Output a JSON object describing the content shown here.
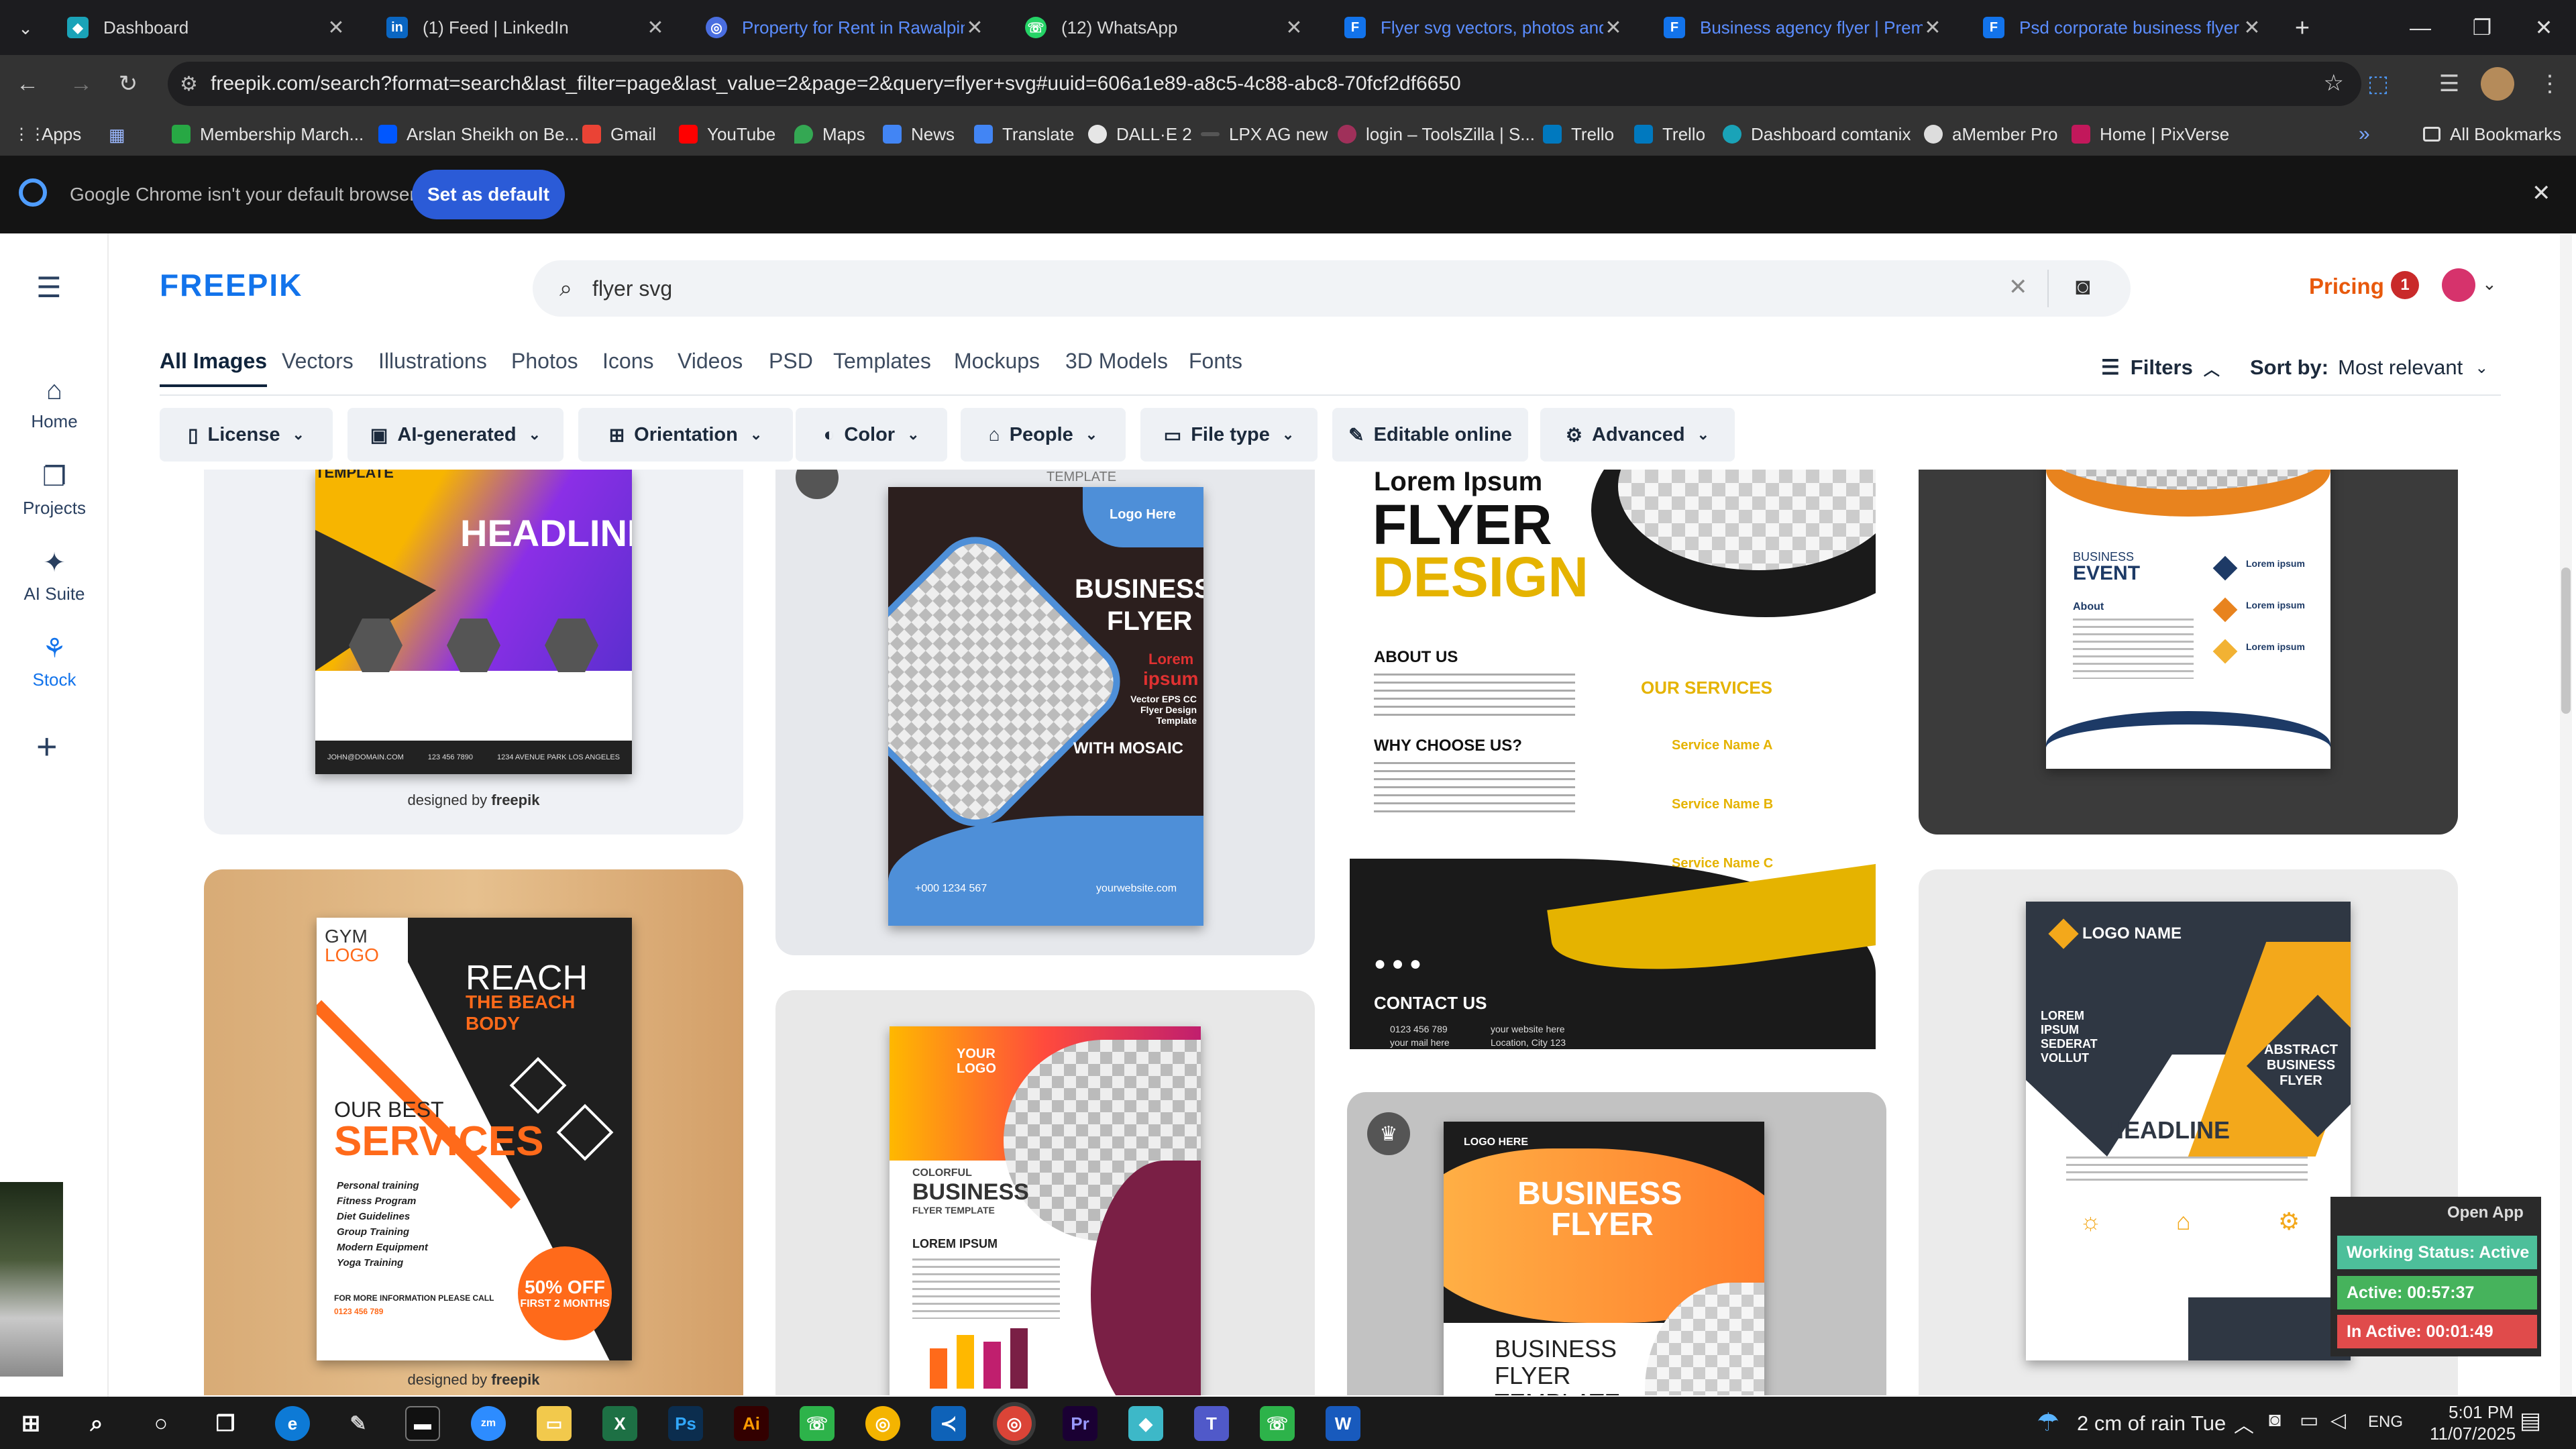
{
  "browser": {
    "tabs": [
      {
        "title": "Dashboard",
        "active": false
      },
      {
        "title": "(1) Feed | LinkedIn",
        "active": false
      },
      {
        "title": "Property for Rent in Rawalpindi",
        "active": false
      },
      {
        "title": "(12) WhatsApp",
        "active": false
      },
      {
        "title": "Flyer svg vectors, photos and P",
        "active": true
      },
      {
        "title": "Business agency flyer | Premium",
        "active": false
      },
      {
        "title": "Psd corporate business flyer de",
        "active": false
      }
    ],
    "new_tab": "+",
    "url": "freepik.com/search?format=search&last_filter=page&last_value=2&page=2&query=flyer+svg#uuid=606a1e89-a8c5-4c88-abc8-70fcf2df6650",
    "bookmarks": [
      "Apps",
      "Membership March...",
      "Arslan Sheikh on Be...",
      "Gmail",
      "YouTube",
      "Maps",
      "News",
      "Translate",
      "DALL·E 2",
      "LPX AG new",
      "login – ToolsZilla | S...",
      "Trello",
      "Trello",
      "Dashboard comtanix",
      "aMember Pro",
      "Home | PixVerse"
    ],
    "all_bookmarks": "All Bookmarks",
    "infobar": {
      "text": "Google Chrome isn't your default browser",
      "button": "Set as default"
    }
  },
  "freepik": {
    "logo": "FREEPIK",
    "search_value": "flyer svg",
    "pricing": "Pricing",
    "notif_count": "1",
    "sidebar": [
      {
        "label": "Home",
        "icon": "home-icon"
      },
      {
        "label": "Projects",
        "icon": "folder-icon"
      },
      {
        "label": "AI Suite",
        "icon": "sparkle-icon"
      },
      {
        "label": "Stock",
        "icon": "stock-icon"
      }
    ],
    "categories": [
      "All Images",
      "Vectors",
      "Illustrations",
      "Photos",
      "Icons",
      "Videos",
      "PSD",
      "Templates",
      "Mockups",
      "3D Models",
      "Fonts"
    ],
    "filters_label": "Filters",
    "sort_label": "Sort by:",
    "sort_value": "Most relevant",
    "chips": [
      "License",
      "AI-generated",
      "Orientation",
      "Color",
      "People",
      "File type",
      "Editable online",
      "Advanced"
    ]
  },
  "results": {
    "designed_by": "designed by",
    "designed_by_brand": "freepik",
    "card1": {
      "label_top": "TEMPLATE",
      "headline": "HEADLINE",
      "footer1": "JOHN@DOMAIN.COM",
      "footer2": "123 456 7890",
      "footer3": "1234 AVENUE PARK LOS ANGELES"
    },
    "card2": {
      "label_top": "TEMPLATE",
      "logo": "Logo Here",
      "title1": "BUSINESS",
      "title2": "FLYER",
      "lorem": "Lorem",
      "ipsum": "ipsum",
      "desc": "Vector EPS CC Flyer Design Template",
      "mosaic": "WITH MOSAIC",
      "phone": "+000 1234 567",
      "web": "yourwebsite.com"
    },
    "card3": {
      "lorem": "Lorem Ipsum",
      "flyer": "FLYER",
      "design": "DESIGN",
      "about": "ABOUT US",
      "why": "WHY CHOOSE US?",
      "services": "OUR SERVICES",
      "sa": "Service Name A",
      "sb": "Service Name B",
      "sc": "Service Name C",
      "contact": "CONTACT US",
      "phone": "0123 456 789",
      "mail": "your mail here",
      "web": "your website here",
      "loc": "Location, City 123"
    },
    "card4": {
      "business": "BUSINESS",
      "event": "EVENT",
      "about": "About",
      "lorem": "Lorem ipsum"
    },
    "card5": {
      "gym": "GYM",
      "logo": "LOGO",
      "reach": "REACH",
      "beach": "THE BEACH BODY",
      "our_best": "OUR BEST",
      "services": "SERVICES",
      "list": [
        "Personal training",
        "Fitness Program",
        "Diet Guidelines",
        "Group Training",
        "Modern Equipment",
        "Yoga Training"
      ],
      "more": "FOR MORE INFORMATION PLEASE CALL",
      "phone": "0123 456 789",
      "offer1": "50% OFF",
      "offer2": "FIRST 2 MONTHS"
    },
    "card6": {
      "your": "YOUR",
      "logo": "LOGO",
      "colorful": "COLORFUL",
      "business": "BUSINESS",
      "template": "FLYER TEMPLATE",
      "lorem": "LOREM IPSUM"
    },
    "card7": {
      "logo": "LOGO HERE",
      "title1": "BUSINESS",
      "title2": "FLYER",
      "title3": "BUSINESS",
      "title4": "FLYER",
      "title5": "TEMPLATE"
    },
    "card8": {
      "logo": "LOGO NAME",
      "lorem": "LOREM IPSUM SEDERAT VOLLUT",
      "abstract": "ABSTRACT BUSINESS FLYER",
      "headline": "HEADLINE"
    }
  },
  "overlay": {
    "open_app": "Open App",
    "status": "Working Status: Active",
    "active": "Active: 00:57:37",
    "inactive": "In Active: 00:01:49"
  },
  "taskbar": {
    "weather": "2 cm of rain Tue",
    "lang": "ENG",
    "time": "5:01 PM",
    "date": "11/07/2025"
  },
  "colors": {
    "brand_blue": "#1273eb",
    "pricing_orange": "#e8590c",
    "chrome_blue": "#2b5bd7"
  }
}
